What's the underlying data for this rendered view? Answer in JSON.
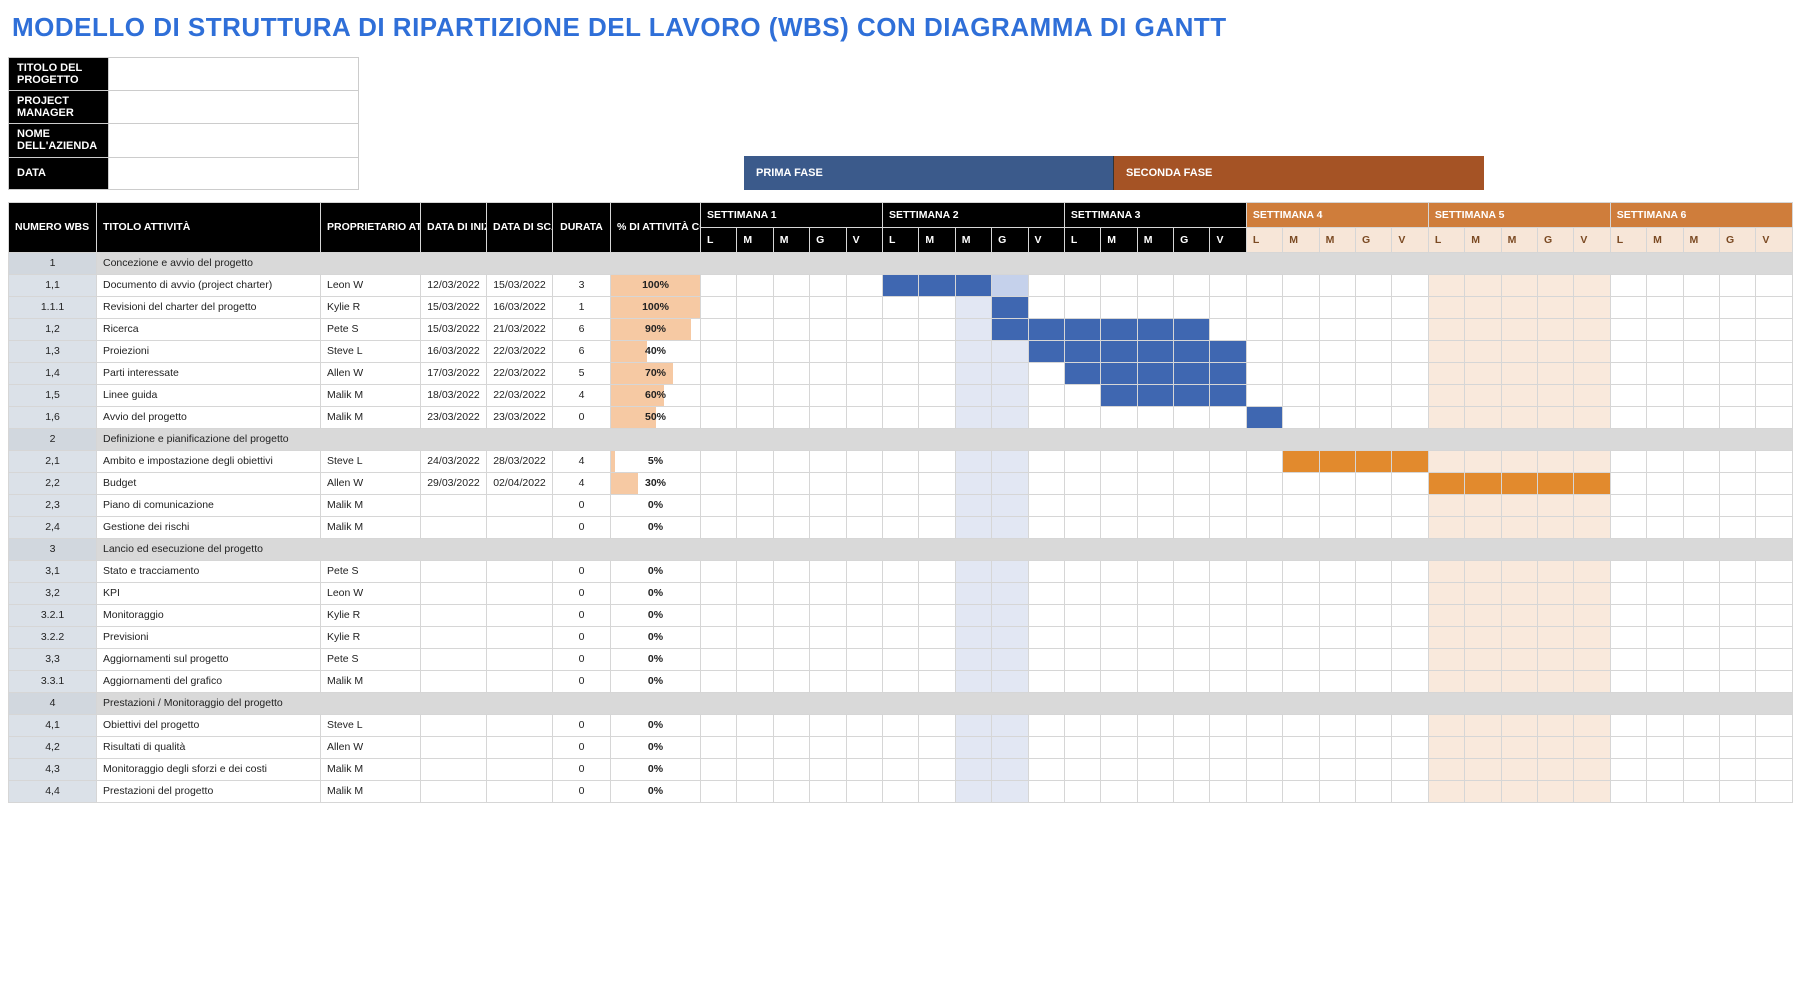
{
  "title": "MODELLO DI STRUTTURA DI RIPARTIZIONE DEL LAVORO (WBS) CON DIAGRAMMA DI GANTT",
  "meta": {
    "project_title_label": "TITOLO DEL PROGETTO",
    "project_title": "",
    "pm_label": "PROJECT MANAGER",
    "pm": "",
    "company_label": "NOME DELL'AZIENDA",
    "company": "",
    "date_label": "DATA",
    "date": ""
  },
  "phases": {
    "p1": "PRIMA FASE",
    "p2": "SECONDA FASE"
  },
  "headers": {
    "wbs": "NUMERO WBS",
    "task": "TITOLO ATTIVITÀ",
    "owner": "PROPRIETARIO ATTIVITÀ",
    "start": "DATA DI INIZIO",
    "due": "DATA DI SCADENZA",
    "dur": "DURATA",
    "pct": "% DI ATTIVITÀ COMPLETATO"
  },
  "weeks": [
    "SETTIMANA 1",
    "SETTIMANA 2",
    "SETTIMANA 3",
    "SETTIMANA 4",
    "SETTIMANA 5",
    "SETTIMANA 6"
  ],
  "days": [
    "L",
    "M",
    "M",
    "G",
    "V"
  ],
  "rows": [
    {
      "type": "phase",
      "wbs": "1",
      "title": "Concezione e avvio del progetto"
    },
    {
      "wbs": "1,1",
      "title": "Documento di avvio (project charter)",
      "owner": "Leon W",
      "start": "12/03/2022",
      "due": "15/03/2022",
      "dur": "3",
      "pct": "100%",
      "fill": 100,
      "bar": [
        5,
        6,
        7
      ],
      "barl": [
        8
      ]
    },
    {
      "wbs": "1.1.1",
      "title": "Revisioni del charter del progetto",
      "owner": "Kylie R",
      "start": "15/03/2022",
      "due": "16/03/2022",
      "dur": "1",
      "pct": "100%",
      "fill": 100,
      "bar": [
        8
      ]
    },
    {
      "wbs": "1,2",
      "title": "Ricerca",
      "owner": "Pete S",
      "start": "15/03/2022",
      "due": "21/03/2022",
      "dur": "6",
      "pct": "90%",
      "fill": 90,
      "bar": [
        8,
        9,
        10,
        11,
        12,
        13
      ]
    },
    {
      "wbs": "1,3",
      "title": "Proiezioni",
      "owner": "Steve L",
      "start": "16/03/2022",
      "due": "22/03/2022",
      "dur": "6",
      "pct": "40%",
      "fill": 40,
      "bar": [
        9,
        10,
        11,
        12,
        13,
        14
      ]
    },
    {
      "wbs": "1,4",
      "title": "Parti interessate",
      "owner": "Allen W",
      "start": "17/03/2022",
      "due": "22/03/2022",
      "dur": "5",
      "pct": "70%",
      "fill": 70,
      "bar": [
        10,
        11,
        12,
        13,
        14
      ]
    },
    {
      "wbs": "1,5",
      "title": "Linee guida",
      "owner": "Malik M",
      "start": "18/03/2022",
      "due": "22/03/2022",
      "dur": "4",
      "pct": "60%",
      "fill": 60,
      "bar": [
        11,
        12,
        13,
        14
      ]
    },
    {
      "wbs": "1,6",
      "title": "Avvio del progetto",
      "owner": "Malik M",
      "start": "23/03/2022",
      "due": "23/03/2022",
      "dur": "0",
      "pct": "50%",
      "fill": 50,
      "bar": [
        15
      ]
    },
    {
      "type": "phase",
      "wbs": "2",
      "title": "Definizione e pianificazione del progetto"
    },
    {
      "wbs": "2,1",
      "title": "Ambito e impostazione degli obiettivi",
      "owner": "Steve L",
      "start": "24/03/2022",
      "due": "28/03/2022",
      "dur": "4",
      "pct": "5%",
      "fill": 5,
      "baro": [
        16,
        17,
        18,
        19
      ]
    },
    {
      "wbs": "2,2",
      "title": "Budget",
      "owner": "Allen W",
      "start": "29/03/2022",
      "due": "02/04/2022",
      "dur": "4",
      "pct": "30%",
      "fill": 30,
      "baro": [
        20,
        21,
        22,
        23,
        24
      ]
    },
    {
      "wbs": "2,3",
      "title": "Piano di comunicazione",
      "owner": "Malik M",
      "start": "",
      "due": "",
      "dur": "0",
      "pct": "0%",
      "fill": 0
    },
    {
      "wbs": "2,4",
      "title": "Gestione dei rischi",
      "owner": "Malik M",
      "start": "",
      "due": "",
      "dur": "0",
      "pct": "0%",
      "fill": 0
    },
    {
      "type": "phase",
      "wbs": "3",
      "title": "Lancio ed esecuzione del progetto"
    },
    {
      "wbs": "3,1",
      "title": "Stato e tracciamento",
      "owner": "Pete S",
      "start": "",
      "due": "",
      "dur": "0",
      "pct": "0%",
      "fill": 0
    },
    {
      "wbs": "3,2",
      "title": "KPI",
      "owner": "Leon W",
      "start": "",
      "due": "",
      "dur": "0",
      "pct": "0%",
      "fill": 0
    },
    {
      "wbs": "3.2.1",
      "title": "Monitoraggio",
      "owner": "Kylie R",
      "start": "",
      "due": "",
      "dur": "0",
      "pct": "0%",
      "fill": 0
    },
    {
      "wbs": "3.2.2",
      "title": "Previsioni",
      "owner": "Kylie R",
      "start": "",
      "due": "",
      "dur": "0",
      "pct": "0%",
      "fill": 0
    },
    {
      "wbs": "3,3",
      "title": "Aggiornamenti sul progetto",
      "owner": "Pete S",
      "start": "",
      "due": "",
      "dur": "0",
      "pct": "0%",
      "fill": 0
    },
    {
      "wbs": "3.3.1",
      "title": "Aggiornamenti del grafico",
      "owner": "Malik M",
      "start": "",
      "due": "",
      "dur": "0",
      "pct": "0%",
      "fill": 0
    },
    {
      "type": "phase",
      "wbs": "4",
      "title": "Prestazioni / Monitoraggio del progetto"
    },
    {
      "wbs": "4,1",
      "title": "Obiettivi del progetto",
      "owner": "Steve L",
      "start": "",
      "due": "",
      "dur": "0",
      "pct": "0%",
      "fill": 0
    },
    {
      "wbs": "4,2",
      "title": "Risultati di qualità",
      "owner": "Allen W",
      "start": "",
      "due": "",
      "dur": "0",
      "pct": "0%",
      "fill": 0
    },
    {
      "wbs": "4,3",
      "title": "Monitoraggio degli sforzi e dei costi",
      "owner": "Malik M",
      "start": "",
      "due": "",
      "dur": "0",
      "pct": "0%",
      "fill": 0
    },
    {
      "wbs": "4,4",
      "title": "Prestazioni del progetto",
      "owner": "Malik M",
      "start": "",
      "due": "",
      "dur": "0",
      "pct": "0%",
      "fill": 0
    }
  ],
  "shade_blue": [
    7,
    8
  ],
  "shade_orange": [
    20,
    21,
    22,
    23,
    24
  ]
}
